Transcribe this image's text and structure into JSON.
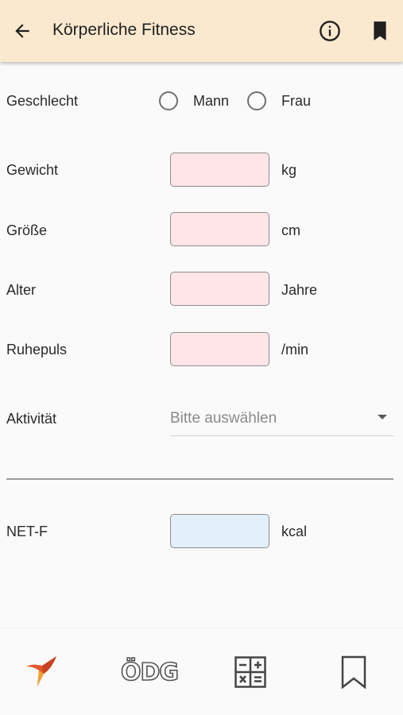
{
  "appbar": {
    "title": "Körperliche Fitness",
    "back_icon": "arrow-back-icon",
    "info_icon": "info-icon",
    "bookmark_icon": "bookmark-filled-icon"
  },
  "form": {
    "gender": {
      "label": "Geschlecht",
      "options": [
        "Mann",
        "Frau"
      ],
      "selected": null
    },
    "weight": {
      "label": "Gewicht",
      "value": "",
      "unit": "kg"
    },
    "height": {
      "label": "Größe",
      "value": "",
      "unit": "cm"
    },
    "age": {
      "label": "Alter",
      "value": "",
      "unit": "Jahre"
    },
    "resting_pulse": {
      "label": "Ruhepuls",
      "value": "",
      "unit": "/min"
    },
    "activity": {
      "label": "Aktivität",
      "placeholder": "Bitte auswählen"
    }
  },
  "result": {
    "label": "NET-F",
    "value": "",
    "unit": "kcal"
  },
  "bottom_nav": {
    "items": [
      {
        "icon": "hummingbird-logo-icon"
      },
      {
        "text": "ÖDG",
        "icon": "odg-logo-icon"
      },
      {
        "icon": "calculator-icon"
      },
      {
        "icon": "bookmark-outline-icon"
      }
    ]
  },
  "colors": {
    "appbar_bg": "#fbe9cf",
    "input_bg": "#ffe5e8",
    "result_bg": "#e3f0fc",
    "logo_orange": "#e0582a"
  }
}
